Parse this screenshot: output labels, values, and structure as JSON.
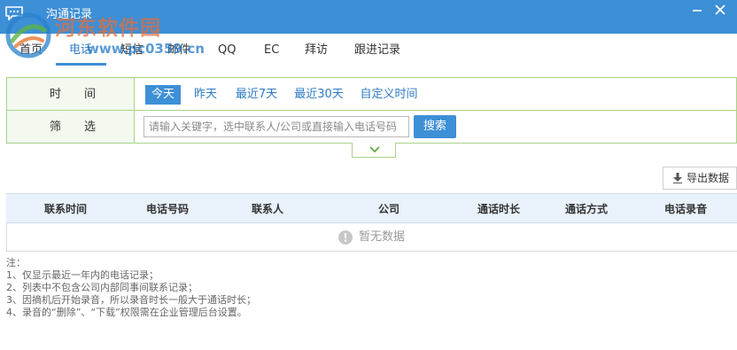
{
  "window": {
    "title": "沟通记录",
    "icons": {
      "app": "chat-bubble-icon",
      "minimize": "minimize-icon",
      "close": "close-icon"
    }
  },
  "watermark": {
    "text": "河东软件园",
    "url": "www.pc0359.cn"
  },
  "tabs": [
    {
      "label": "首页",
      "active": false
    },
    {
      "label": "电话",
      "active": true
    },
    {
      "label": "短信",
      "active": false
    },
    {
      "label": "邮件",
      "active": false
    },
    {
      "label": "QQ",
      "active": false
    },
    {
      "label": "EC",
      "active": false
    },
    {
      "label": "拜访",
      "active": false
    },
    {
      "label": "跟进记录",
      "active": false
    }
  ],
  "filter": {
    "time_label": "时　　间",
    "filter_label": "筛　　选",
    "time_options": [
      {
        "label": "今天",
        "active": true
      },
      {
        "label": "昨天",
        "active": false
      },
      {
        "label": "最近7天",
        "active": false
      },
      {
        "label": "最近30天",
        "active": false
      },
      {
        "label": "自定义时间",
        "active": false
      }
    ],
    "search_placeholder": "请输入关键字，选中联系人/公司或直接输入电话号码",
    "search_value": "",
    "search_button": "搜索",
    "collapse_icon": "chevron-down-icon"
  },
  "toolbar": {
    "export_label": "导出数据",
    "export_icon": "download-icon"
  },
  "table": {
    "columns": [
      "联系时间",
      "电话号码",
      "联系人",
      "公司",
      "通话时长",
      "通话方式",
      "电话录音"
    ],
    "rows": [],
    "empty_text": "暂无数据",
    "empty_icon": "info-icon"
  },
  "notes": [
    "注：",
    "1、仅显示最近一年内的电话记录；",
    "2、列表中不包含公司内部同事间联系记录；",
    "3、因摘机后开始录音，所以录音时长一般大于通话时长；",
    "4、录音的“删除”、“下载”权限需在企业管理后台设置。"
  ],
  "colors": {
    "accent": "#3d8fd6",
    "filter_border": "#a8d38a",
    "header_bg": "#e9f2fb"
  }
}
